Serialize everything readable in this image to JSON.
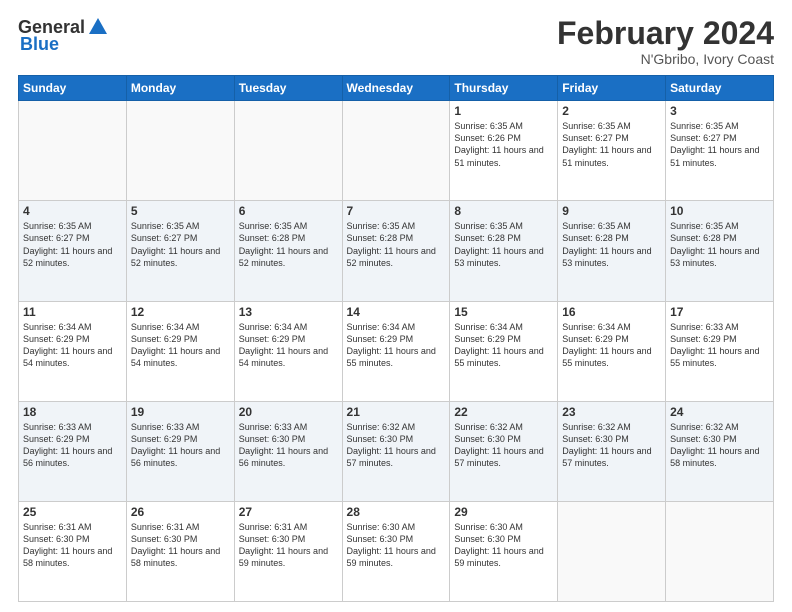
{
  "header": {
    "logo_general": "General",
    "logo_blue": "Blue",
    "month": "February 2024",
    "location": "N'Gbribo, Ivory Coast"
  },
  "weekdays": [
    "Sunday",
    "Monday",
    "Tuesday",
    "Wednesday",
    "Thursday",
    "Friday",
    "Saturday"
  ],
  "weeks": [
    [
      {
        "day": "",
        "sunrise": "",
        "sunset": "",
        "daylight": ""
      },
      {
        "day": "",
        "sunrise": "",
        "sunset": "",
        "daylight": ""
      },
      {
        "day": "",
        "sunrise": "",
        "sunset": "",
        "daylight": ""
      },
      {
        "day": "",
        "sunrise": "",
        "sunset": "",
        "daylight": ""
      },
      {
        "day": "1",
        "sunrise": "Sunrise: 6:35 AM",
        "sunset": "Sunset: 6:26 PM",
        "daylight": "Daylight: 11 hours and 51 minutes."
      },
      {
        "day": "2",
        "sunrise": "Sunrise: 6:35 AM",
        "sunset": "Sunset: 6:27 PM",
        "daylight": "Daylight: 11 hours and 51 minutes."
      },
      {
        "day": "3",
        "sunrise": "Sunrise: 6:35 AM",
        "sunset": "Sunset: 6:27 PM",
        "daylight": "Daylight: 11 hours and 51 minutes."
      }
    ],
    [
      {
        "day": "4",
        "sunrise": "Sunrise: 6:35 AM",
        "sunset": "Sunset: 6:27 PM",
        "daylight": "Daylight: 11 hours and 52 minutes."
      },
      {
        "day": "5",
        "sunrise": "Sunrise: 6:35 AM",
        "sunset": "Sunset: 6:27 PM",
        "daylight": "Daylight: 11 hours and 52 minutes."
      },
      {
        "day": "6",
        "sunrise": "Sunrise: 6:35 AM",
        "sunset": "Sunset: 6:28 PM",
        "daylight": "Daylight: 11 hours and 52 minutes."
      },
      {
        "day": "7",
        "sunrise": "Sunrise: 6:35 AM",
        "sunset": "Sunset: 6:28 PM",
        "daylight": "Daylight: 11 hours and 52 minutes."
      },
      {
        "day": "8",
        "sunrise": "Sunrise: 6:35 AM",
        "sunset": "Sunset: 6:28 PM",
        "daylight": "Daylight: 11 hours and 53 minutes."
      },
      {
        "day": "9",
        "sunrise": "Sunrise: 6:35 AM",
        "sunset": "Sunset: 6:28 PM",
        "daylight": "Daylight: 11 hours and 53 minutes."
      },
      {
        "day": "10",
        "sunrise": "Sunrise: 6:35 AM",
        "sunset": "Sunset: 6:28 PM",
        "daylight": "Daylight: 11 hours and 53 minutes."
      }
    ],
    [
      {
        "day": "11",
        "sunrise": "Sunrise: 6:34 AM",
        "sunset": "Sunset: 6:29 PM",
        "daylight": "Daylight: 11 hours and 54 minutes."
      },
      {
        "day": "12",
        "sunrise": "Sunrise: 6:34 AM",
        "sunset": "Sunset: 6:29 PM",
        "daylight": "Daylight: 11 hours and 54 minutes."
      },
      {
        "day": "13",
        "sunrise": "Sunrise: 6:34 AM",
        "sunset": "Sunset: 6:29 PM",
        "daylight": "Daylight: 11 hours and 54 minutes."
      },
      {
        "day": "14",
        "sunrise": "Sunrise: 6:34 AM",
        "sunset": "Sunset: 6:29 PM",
        "daylight": "Daylight: 11 hours and 55 minutes."
      },
      {
        "day": "15",
        "sunrise": "Sunrise: 6:34 AM",
        "sunset": "Sunset: 6:29 PM",
        "daylight": "Daylight: 11 hours and 55 minutes."
      },
      {
        "day": "16",
        "sunrise": "Sunrise: 6:34 AM",
        "sunset": "Sunset: 6:29 PM",
        "daylight": "Daylight: 11 hours and 55 minutes."
      },
      {
        "day": "17",
        "sunrise": "Sunrise: 6:33 AM",
        "sunset": "Sunset: 6:29 PM",
        "daylight": "Daylight: 11 hours and 55 minutes."
      }
    ],
    [
      {
        "day": "18",
        "sunrise": "Sunrise: 6:33 AM",
        "sunset": "Sunset: 6:29 PM",
        "daylight": "Daylight: 11 hours and 56 minutes."
      },
      {
        "day": "19",
        "sunrise": "Sunrise: 6:33 AM",
        "sunset": "Sunset: 6:29 PM",
        "daylight": "Daylight: 11 hours and 56 minutes."
      },
      {
        "day": "20",
        "sunrise": "Sunrise: 6:33 AM",
        "sunset": "Sunset: 6:30 PM",
        "daylight": "Daylight: 11 hours and 56 minutes."
      },
      {
        "day": "21",
        "sunrise": "Sunrise: 6:32 AM",
        "sunset": "Sunset: 6:30 PM",
        "daylight": "Daylight: 11 hours and 57 minutes."
      },
      {
        "day": "22",
        "sunrise": "Sunrise: 6:32 AM",
        "sunset": "Sunset: 6:30 PM",
        "daylight": "Daylight: 11 hours and 57 minutes."
      },
      {
        "day": "23",
        "sunrise": "Sunrise: 6:32 AM",
        "sunset": "Sunset: 6:30 PM",
        "daylight": "Daylight: 11 hours and 57 minutes."
      },
      {
        "day": "24",
        "sunrise": "Sunrise: 6:32 AM",
        "sunset": "Sunset: 6:30 PM",
        "daylight": "Daylight: 11 hours and 58 minutes."
      }
    ],
    [
      {
        "day": "25",
        "sunrise": "Sunrise: 6:31 AM",
        "sunset": "Sunset: 6:30 PM",
        "daylight": "Daylight: 11 hours and 58 minutes."
      },
      {
        "day": "26",
        "sunrise": "Sunrise: 6:31 AM",
        "sunset": "Sunset: 6:30 PM",
        "daylight": "Daylight: 11 hours and 58 minutes."
      },
      {
        "day": "27",
        "sunrise": "Sunrise: 6:31 AM",
        "sunset": "Sunset: 6:30 PM",
        "daylight": "Daylight: 11 hours and 59 minutes."
      },
      {
        "day": "28",
        "sunrise": "Sunrise: 6:30 AM",
        "sunset": "Sunset: 6:30 PM",
        "daylight": "Daylight: 11 hours and 59 minutes."
      },
      {
        "day": "29",
        "sunrise": "Sunrise: 6:30 AM",
        "sunset": "Sunset: 6:30 PM",
        "daylight": "Daylight: 11 hours and 59 minutes."
      },
      {
        "day": "",
        "sunrise": "",
        "sunset": "",
        "daylight": ""
      },
      {
        "day": "",
        "sunrise": "",
        "sunset": "",
        "daylight": ""
      }
    ]
  ]
}
